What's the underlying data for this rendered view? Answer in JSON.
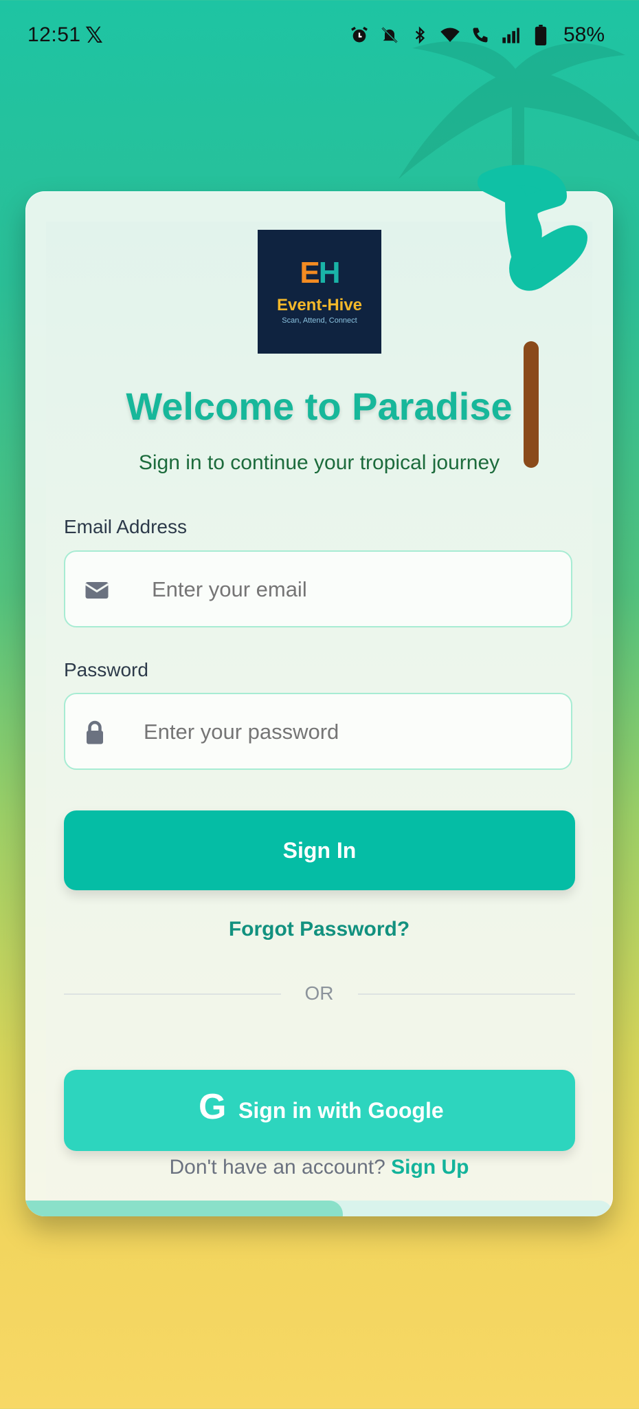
{
  "status_bar": {
    "time": "12:51",
    "app_icon": "x-icon",
    "icons": [
      "alarm-icon",
      "bell-off-icon",
      "bluetooth-icon",
      "wifi-icon",
      "wifi-call-icon",
      "signal-icon",
      "battery-icon"
    ],
    "battery": "58%"
  },
  "logo": {
    "letters_e": "E",
    "letters_h": "H",
    "name": "Event-Hive",
    "tagline": "Scan, Attend, Connect"
  },
  "header": {
    "title": "Welcome to Paradise",
    "subtitle": "Sign in to continue your tropical journey"
  },
  "form": {
    "email_label": "Email Address",
    "email_placeholder": "Enter your email",
    "email_value": "",
    "password_label": "Password",
    "password_placeholder": "Enter your password",
    "password_value": "",
    "sign_in": "Sign In",
    "forgot": "Forgot Password?",
    "or": "OR",
    "google": "Sign in with Google",
    "google_icon": "G",
    "no_account": "Don't have an account?",
    "sign_up": "Sign Up"
  },
  "progress": {
    "value": 0.54
  },
  "colors": {
    "accent": "#05bda5",
    "google_button": "#2dd5be",
    "title": "#17b79a",
    "logo_bg": "#0f2340"
  }
}
